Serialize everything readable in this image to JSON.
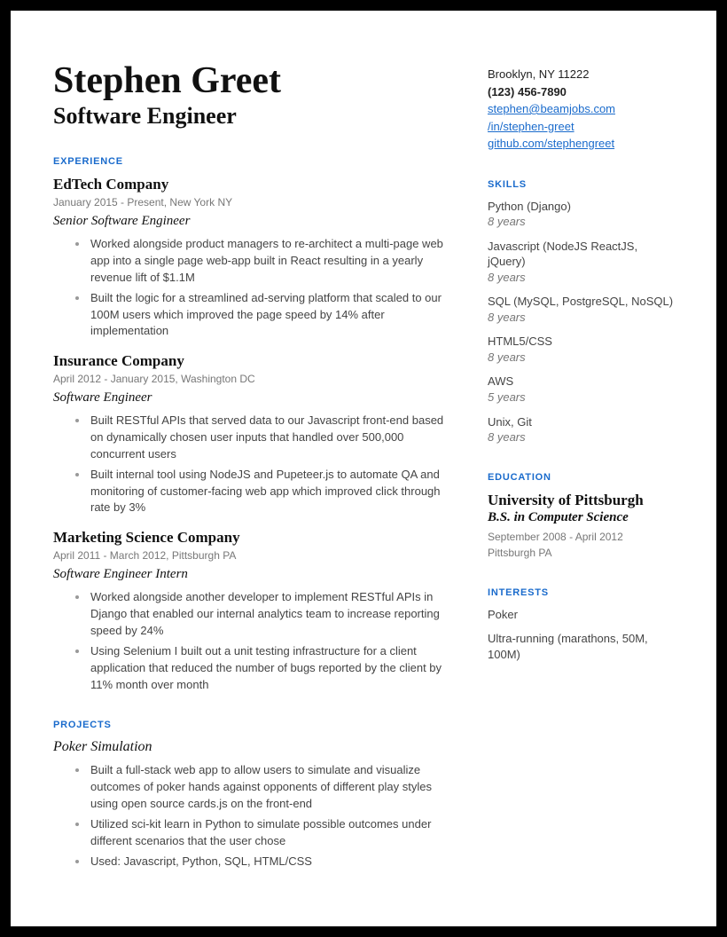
{
  "name": "Stephen Greet",
  "title": "Software Engineer",
  "contact": {
    "location": "Brooklyn, NY 11222",
    "phone": "(123) 456-7890",
    "email": "stephen@beamjobs.com",
    "linkedin": "/in/stephen-greet",
    "github": "github.com/stephengreet"
  },
  "sections": {
    "experience": "EXPERIENCE",
    "projects": "PROJECTS",
    "skills": "SKILLS",
    "education": "EDUCATION",
    "interests": "INTERESTS"
  },
  "experience": [
    {
      "company": "EdTech Company",
      "meta": "January 2015 - Present, New York NY",
      "role": "Senior Software Engineer",
      "bullets": [
        "Worked alongside product managers to re-architect a multi-page web app into a single page web-app built in React resulting in a yearly revenue lift of $1.1M",
        "Built the logic for  a streamlined ad-serving platform that scaled to our 100M users which improved the page speed by 14% after implementation"
      ]
    },
    {
      "company": "Insurance Company",
      "meta": "April 2012 - January 2015, Washington DC",
      "role": "Software Engineer",
      "bullets": [
        "Built RESTful APIs that served data to our Javascript front-end based on dynamically chosen user inputs that handled over 500,000 concurrent users",
        "Built internal tool using NodeJS and Pupeteer.js to automate QA and monitoring of customer-facing web app which improved click through rate by 3%"
      ]
    },
    {
      "company": "Marketing Science Company",
      "meta": "April 2011 - March 2012, Pittsburgh PA",
      "role": "Software Engineer Intern",
      "bullets": [
        "Worked alongside another developer to implement RESTful APIs in Django that enabled our internal analytics team to increase reporting speed by 24%",
        "Using Selenium I built out a unit testing infrastructure for a client application that reduced the number of bugs reported by the client by 11% month over month"
      ]
    }
  ],
  "projects": [
    {
      "name": "Poker Simulation",
      "bullets": [
        "Built a full-stack web app to allow users to simulate and visualize outcomes of poker hands against opponents of different play styles using open source cards.js on the front-end",
        "Utilized  sci-kit learn in Python to simulate possible outcomes under different scenarios that the user chose",
        "Used: Javascript, Python, SQL, HTML/CSS"
      ]
    }
  ],
  "skills": [
    {
      "name": "Python (Django)",
      "duration": "8 years"
    },
    {
      "name": "Javascript (NodeJS ReactJS, jQuery)",
      "duration": "8 years"
    },
    {
      "name": "SQL  (MySQL, PostgreSQL, NoSQL)",
      "duration": "8 years"
    },
    {
      "name": "HTML5/CSS",
      "duration": "8 years"
    },
    {
      "name": "AWS",
      "duration": "5 years"
    },
    {
      "name": "Unix, Git",
      "duration": "8 years"
    }
  ],
  "education": {
    "school": "University of Pittsburgh",
    "degree": "B.S. in Computer Science",
    "dates": "September 2008 - April 2012",
    "location": "Pittsburgh PA"
  },
  "interests": [
    "Poker",
    "Ultra-running (marathons, 50M, 100M)"
  ]
}
